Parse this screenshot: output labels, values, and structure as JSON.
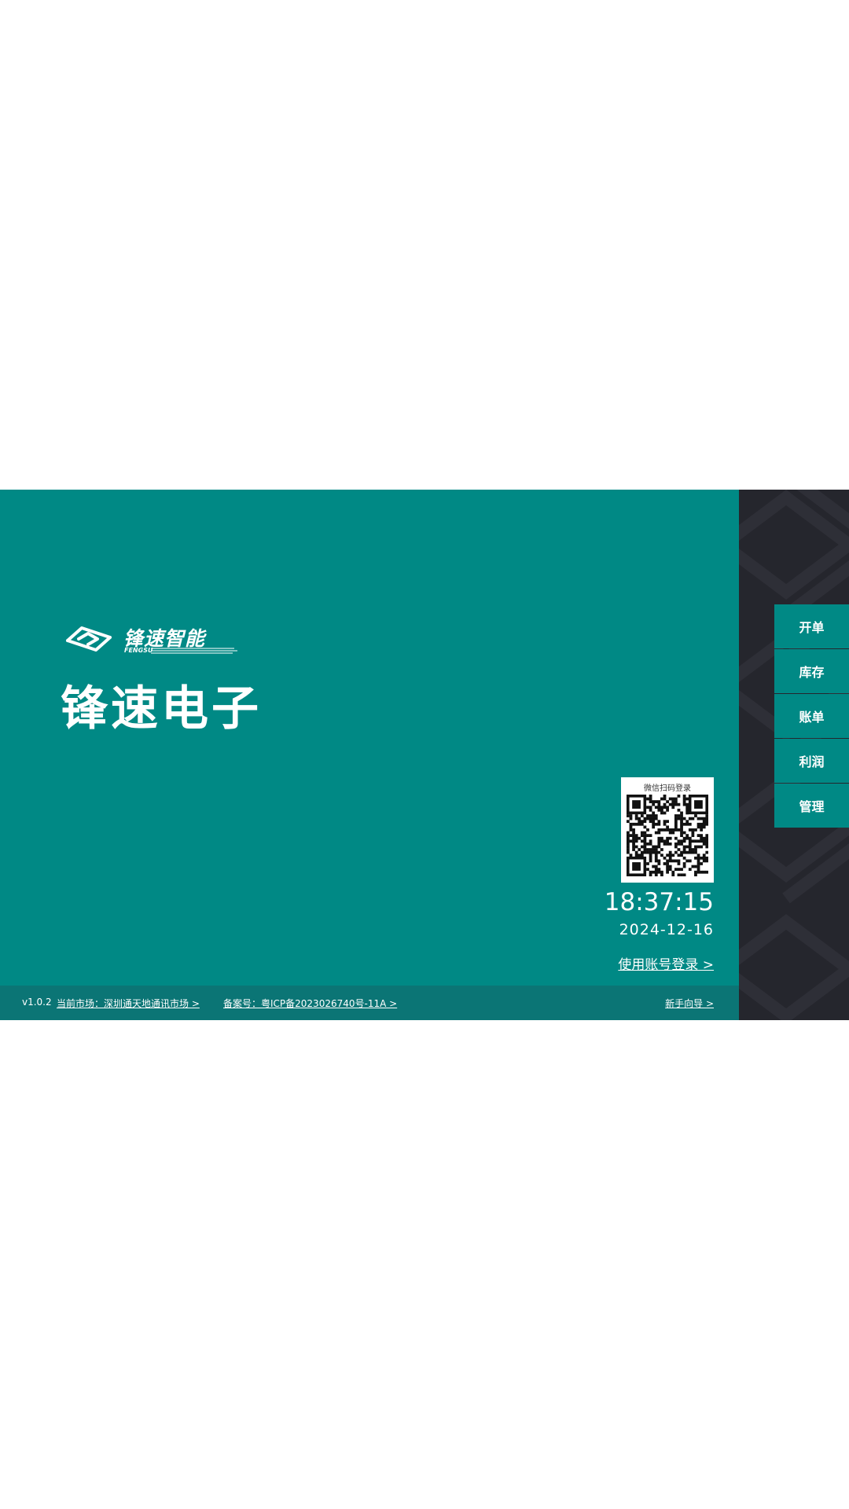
{
  "brand": {
    "name": "锋速智能",
    "english": "FENGSU"
  },
  "store_title": "锋速电子",
  "qr": {
    "label": "微信扫码登录"
  },
  "clock": {
    "time": "18:37:15",
    "date": "2024-12-16"
  },
  "account_login": "使用账号登录 >",
  "footer": {
    "version": "v1.0.2",
    "market": "当前市场：深圳通天地通讯市场 >",
    "icp": "备案号：粤ICP备2023026740号-11A >",
    "guide": "新手向导 >"
  },
  "menu": [
    "开单",
    "库存",
    "账单",
    "利润",
    "管理"
  ],
  "colors": {
    "primary": "#008985",
    "footer": "#0b7575",
    "sidebar": "#25262d",
    "sidebar_pattern": "#2e2f37"
  }
}
